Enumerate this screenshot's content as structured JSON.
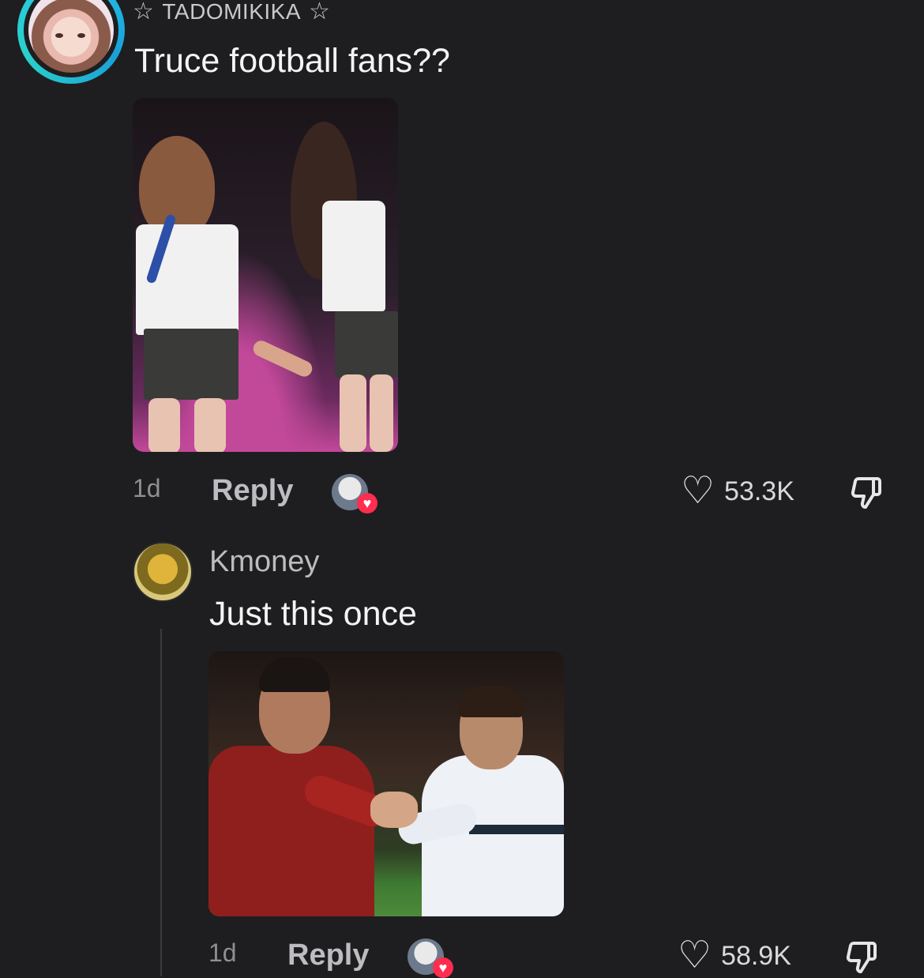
{
  "comment": {
    "username": "TADOMIKIKA",
    "username_decoration": "☆",
    "text": "Truce football fans??",
    "time": "1d",
    "reply_label": "Reply",
    "likes": "53.3K"
  },
  "reply": {
    "username": "Kmoney",
    "text": "Just this once",
    "time": "1d",
    "reply_label": "Reply",
    "likes": "58.9K"
  },
  "icons": {
    "like": "heart-outline-icon",
    "dislike": "thumbs-down-icon",
    "creator_liked": "creator-liked-heart-icon"
  },
  "colors": {
    "background": "#1e1e20",
    "avatar_ring": "#26c6e8",
    "creator_heart": "#ff2d4f"
  }
}
